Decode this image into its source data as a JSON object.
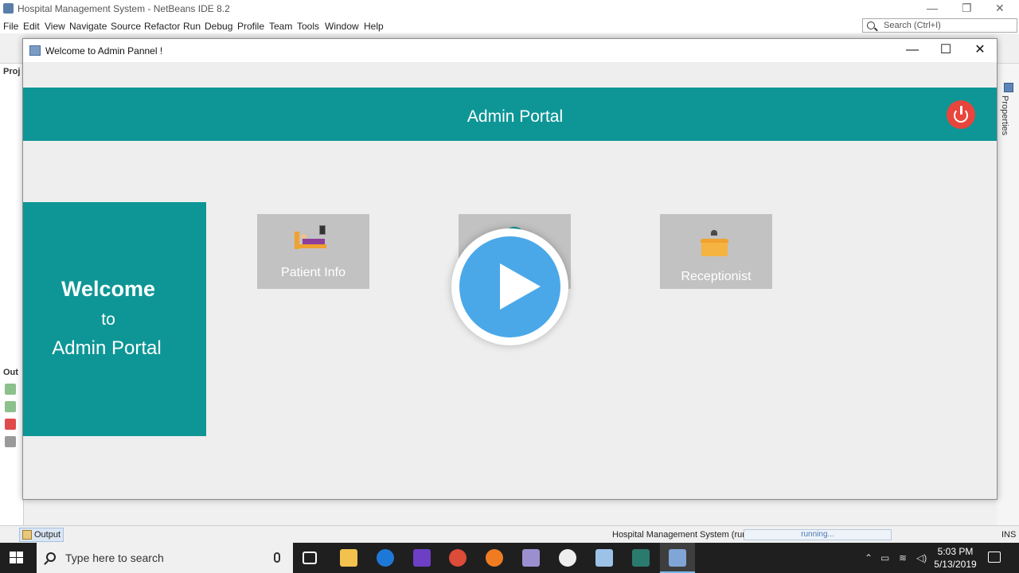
{
  "ide": {
    "title": "Hospital Management System - NetBeans IDE 8.2",
    "menu": [
      "File",
      "Edit",
      "View",
      "Navigate",
      "Source",
      "Refactor",
      "Run",
      "Debug",
      "Profile",
      "Team",
      "Tools",
      "Window",
      "Help"
    ],
    "search_placeholder": "Search (Ctrl+I)",
    "projects_tab": "Proj",
    "output_side_tab": "Out",
    "properties_label": "Properties",
    "status": {
      "output_tab": "Output",
      "run_label": "Hospital Management System (run)",
      "progress_text": "running...",
      "mode": "INS"
    }
  },
  "window": {
    "title": "Welcome to Admin Pannel !",
    "header_title": "Admin Portal",
    "welcome": {
      "line1": "Welcome",
      "line2": "to",
      "line3": "Admin Portal"
    },
    "tiles": [
      {
        "label": "Patient Info",
        "icon": "patient-bed-icon"
      },
      {
        "label": "",
        "icon": "doctor-icon"
      },
      {
        "label": "Receptionist",
        "icon": "reception-desk-icon"
      }
    ]
  },
  "taskbar": {
    "search_placeholder": "Type here to search",
    "time": "5:03 PM",
    "date": "5/13/2019"
  },
  "colors": {
    "teal": "#0e9696",
    "tile_gray": "#c2c2c2",
    "power_red": "#e8453c",
    "play_blue": "#4ba8e8"
  }
}
